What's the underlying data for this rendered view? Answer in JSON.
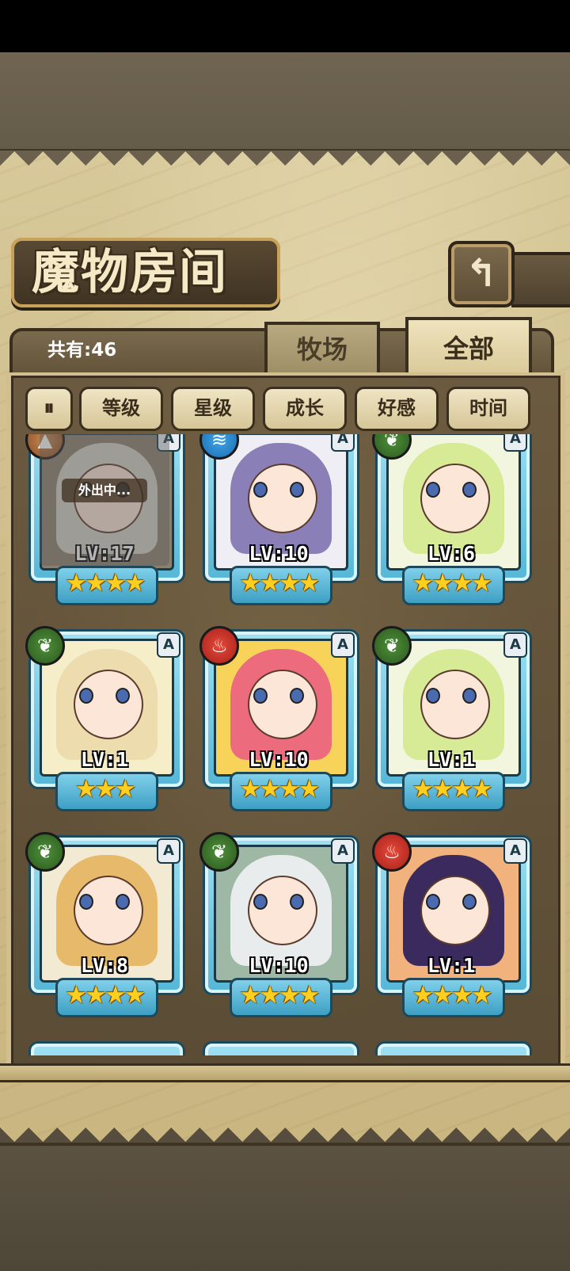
{
  "header": {
    "title": "魔物房间",
    "back_icon": "↰"
  },
  "panel": {
    "count": "共有:46",
    "tabs": [
      {
        "label": "牧场",
        "active": false
      },
      {
        "label": "全部",
        "active": true
      }
    ]
  },
  "sort_bar": {
    "toggle_icon": "⏸",
    "buttons": [
      "等级",
      "星级",
      "成长",
      "好感",
      "时间"
    ]
  },
  "monsters": [
    {
      "level": "LV:17",
      "stars": "★★★★",
      "rank": "A",
      "element": "earth",
      "element_glyph": "▲",
      "status": "外出中...",
      "hair": "#d6d2c6",
      "bg": "#8a8070"
    },
    {
      "level": "LV:10",
      "stars": "★★★★",
      "rank": "A",
      "element": "water",
      "element_glyph": "≋",
      "status": "",
      "hair": "#8a7fb6",
      "bg": "#f0eef5"
    },
    {
      "level": "LV:6",
      "stars": "★★★★",
      "rank": "A",
      "element": "leaf",
      "element_glyph": "❦",
      "status": "",
      "hair": "#d7ea95",
      "bg": "#f3f6de"
    },
    {
      "level": "LV:1",
      "stars": "★★★",
      "rank": "A",
      "element": "leaf",
      "element_glyph": "❦",
      "status": "",
      "hair": "#ecdcae",
      "bg": "#f6edc9"
    },
    {
      "level": "LV:10",
      "stars": "★★★★",
      "rank": "A",
      "element": "fire",
      "element_glyph": "♨",
      "status": "",
      "hair": "#ec6b7d",
      "bg": "#f8d35a"
    },
    {
      "level": "LV:1",
      "stars": "★★★★",
      "rank": "A",
      "element": "leaf",
      "element_glyph": "❦",
      "status": "",
      "hair": "#d7ea95",
      "bg": "#f3f6de"
    },
    {
      "level": "LV:8",
      "stars": "★★★★",
      "rank": "A",
      "element": "leaf",
      "element_glyph": "❦",
      "status": "",
      "hair": "#e7b96a",
      "bg": "#f3ead4"
    },
    {
      "level": "LV:10",
      "stars": "★★★★",
      "rank": "A",
      "element": "leaf",
      "element_glyph": "❦",
      "status": "",
      "hair": "#e8ecec",
      "bg": "#9fb8a6"
    },
    {
      "level": "LV:1",
      "stars": "★★★★",
      "rank": "A",
      "element": "fire",
      "element_glyph": "♨",
      "status": "",
      "hair": "#3b2a5e",
      "bg": "#f2b27e"
    }
  ],
  "colors": {
    "card_frame": "#56b6d6",
    "star": "#ffcf1f",
    "parchment": "#d8c99a"
  }
}
